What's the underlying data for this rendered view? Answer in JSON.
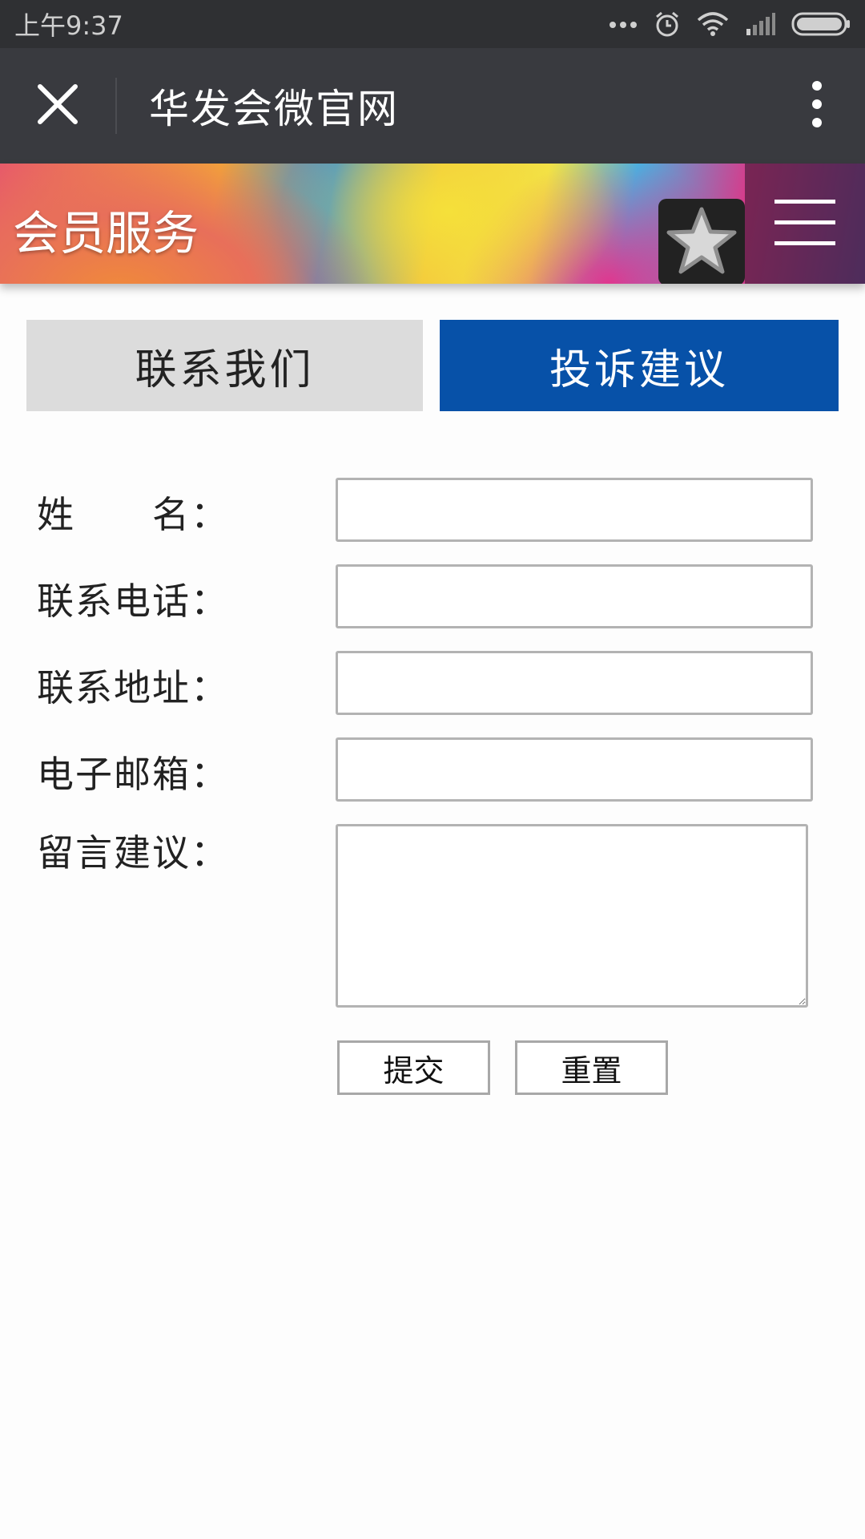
{
  "status_bar": {
    "time": "上午9:37"
  },
  "title_bar": {
    "title": "华发会微官网"
  },
  "banner": {
    "title": "会员服务"
  },
  "tabs": [
    {
      "label": "联系我们",
      "active": false
    },
    {
      "label": "投诉建议",
      "active": true
    }
  ],
  "form": {
    "fields": [
      {
        "label": "姓　　名：",
        "value": ""
      },
      {
        "label": "联系电话：",
        "value": ""
      },
      {
        "label": "联系地址：",
        "value": ""
      },
      {
        "label": "电子邮箱：",
        "value": ""
      }
    ],
    "message_label": "留言建议：",
    "message_value": "",
    "submit_label": "提交",
    "reset_label": "重置"
  },
  "colors": {
    "active_tab": "#0751a8",
    "inactive_tab": "#dcdcdc",
    "title_bar": "#393a3f",
    "status_bar": "#2f3033"
  },
  "icons": [
    "signal-dots-icon",
    "alarm-icon",
    "wifi-icon",
    "cell-signal-icon",
    "battery-icon",
    "close-icon",
    "more-vertical-icon",
    "star-icon",
    "hamburger-menu-icon"
  ]
}
